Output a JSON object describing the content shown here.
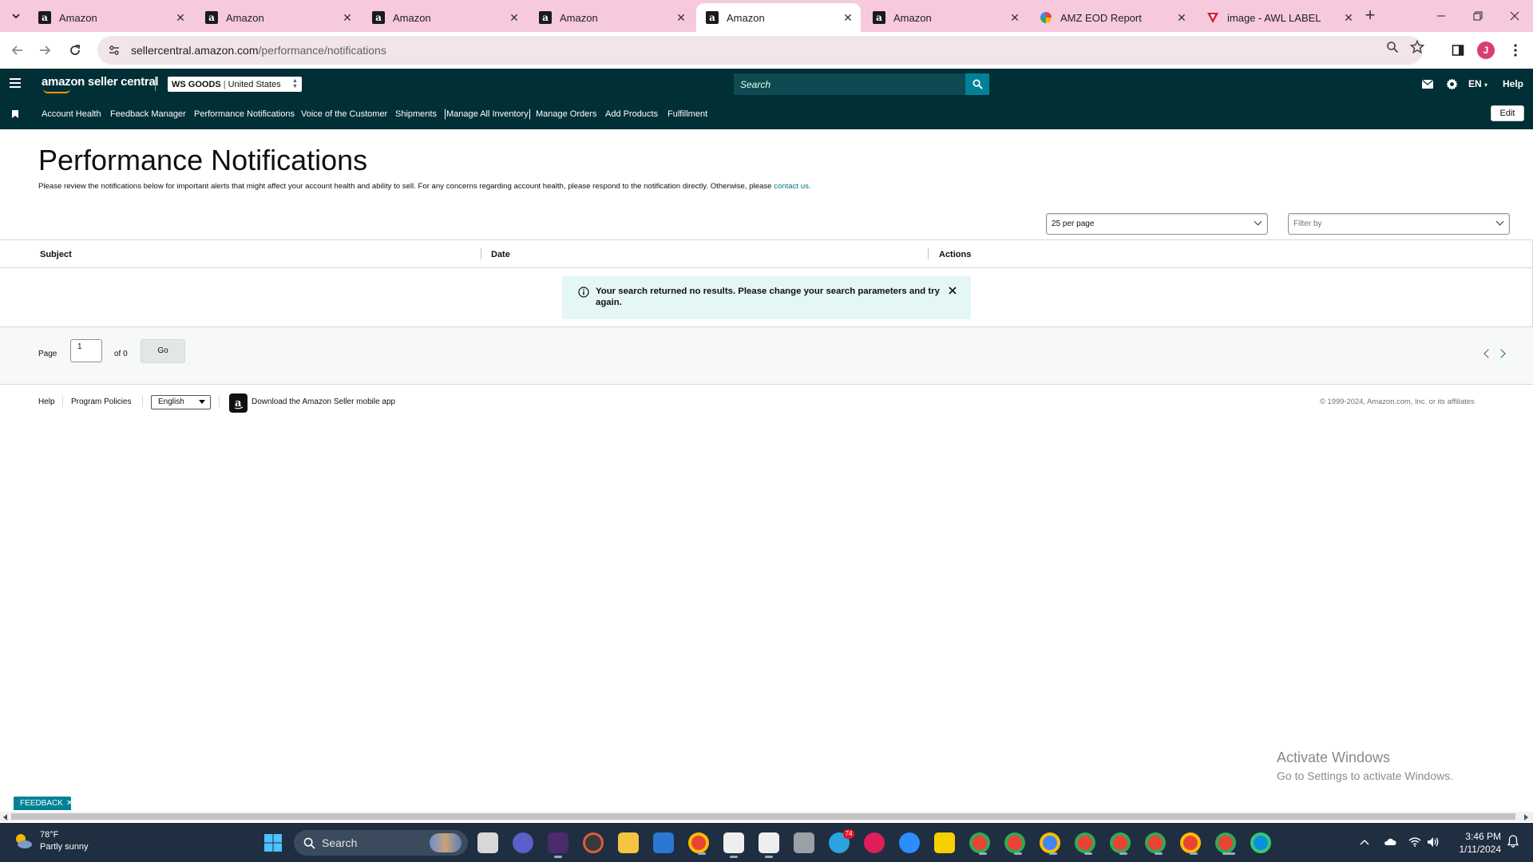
{
  "browser": {
    "tabs": [
      {
        "title": "Amazon",
        "favicon": "amazon-a-icon",
        "active": false
      },
      {
        "title": "Amazon",
        "favicon": "amazon-a-icon",
        "active": false
      },
      {
        "title": "Amazon",
        "favicon": "amazon-a-icon",
        "active": false
      },
      {
        "title": "Amazon",
        "favicon": "amazon-a-icon",
        "active": false
      },
      {
        "title": "Amazon",
        "favicon": "amazon-a-icon",
        "active": true
      },
      {
        "title": "Amazon",
        "favicon": "amazon-a-icon",
        "active": false
      },
      {
        "title": "AMZ EOD Report",
        "favicon": "colorful-pinwheel-icon",
        "active": false
      },
      {
        "title": "image - AWL LABEL",
        "favicon": "red-v-icon",
        "active": false
      }
    ],
    "url_domain": "sellercentral.amazon.com",
    "url_path": "/performance/notifications",
    "profile_initial": "J",
    "tab_strip_color": "#f6c9dd"
  },
  "header": {
    "logo_text": "amazon seller central",
    "store_name": "WS GOODS",
    "marketplace": "United States",
    "search_placeholder": "Search",
    "language": "EN",
    "help_label": "Help",
    "bg_color": "#002f36"
  },
  "nav": {
    "items": [
      "Account Health",
      "Feedback Manager",
      "Performance Notifications",
      "Voice of the Customer",
      "Shipments",
      "Manage All Inventory",
      "Manage Orders",
      "Add Products",
      "Fulfillment"
    ],
    "edit_label": "Edit"
  },
  "page": {
    "title": "Performance Notifications",
    "description": "Please review the notifications below for important alerts that might affect your account health and ability to sell. For any concerns regarding account health, please respond to the notification directly. Otherwise, please ",
    "contact_link": "contact us.",
    "per_page": "25 per page",
    "filter_placeholder": "Filter by",
    "columns": [
      "Subject",
      "Date",
      "Actions"
    ],
    "empty_message": "Your search returned no results. Please change your search parameters and try again.",
    "pager": {
      "label": "Page",
      "current": "1",
      "of": "of 0",
      "go": "Go"
    }
  },
  "footer": {
    "links": [
      "Help",
      "Program Policies"
    ],
    "language": "English",
    "app_text": "Download the Amazon Seller mobile app",
    "copyright": "© 1999-2024, Amazon.com, Inc. or its affiliates"
  },
  "overlay": {
    "activate_title": "Activate Windows",
    "activate_sub": "Go to Settings to activate Windows.",
    "feedback": "FEEDBACK"
  },
  "taskbar": {
    "temperature": "78°F",
    "condition": "Partly sunny",
    "search_label": "Search",
    "time": "3:46 PM",
    "date": "1/11/2024",
    "telegram_badge": "74"
  }
}
